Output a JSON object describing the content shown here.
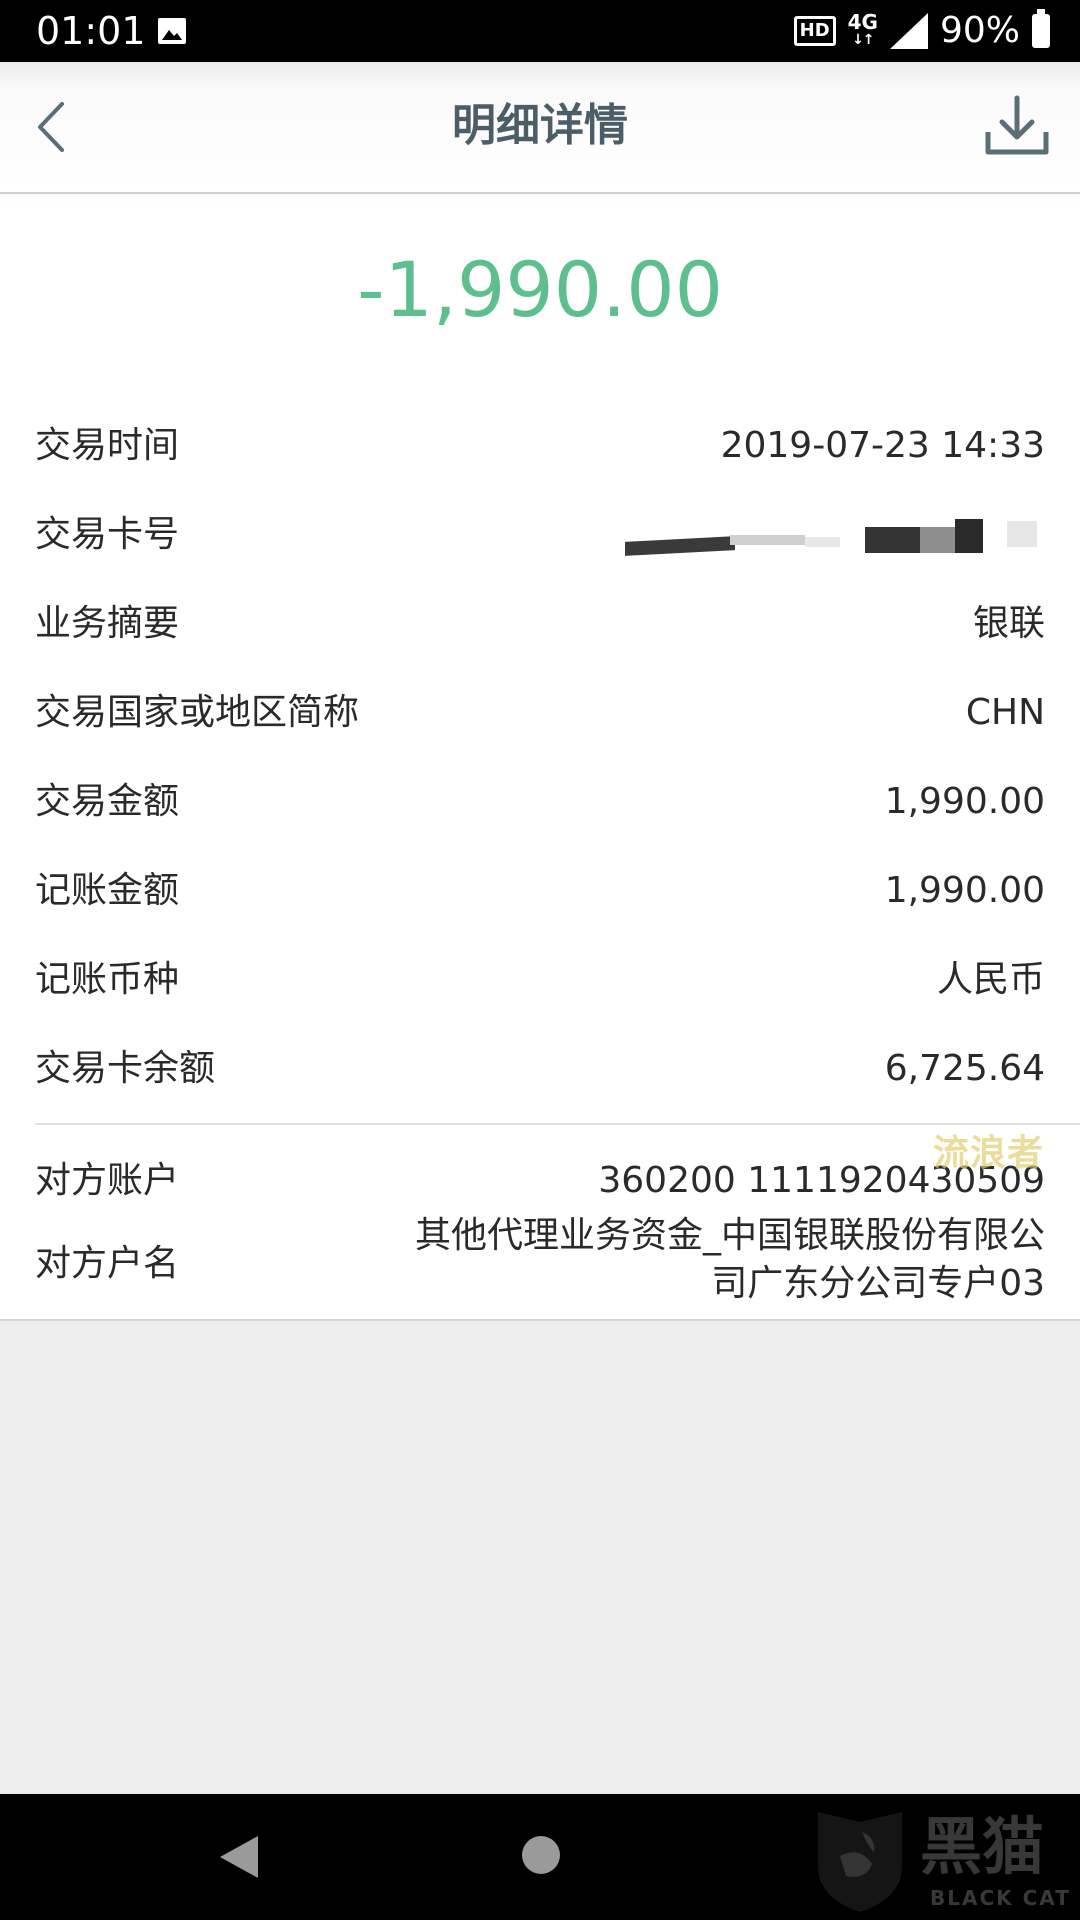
{
  "status_bar": {
    "time": "01:01",
    "hd": "HD",
    "network": "4G",
    "battery": "90%",
    "icons": [
      "photo-icon",
      "signal-icon",
      "battery-icon"
    ]
  },
  "header": {
    "title": "明细详情",
    "back_icon": "chevron-left-icon",
    "download_icon": "download-icon"
  },
  "amount": "-1,990.00",
  "details": [
    {
      "label": "交易时间",
      "value": "2019-07-23 14:33"
    },
    {
      "label": "交易卡号",
      "value": ""
    },
    {
      "label": "业务摘要",
      "value": "银联"
    },
    {
      "label": "交易国家或地区简称",
      "value": "CHN"
    },
    {
      "label": "交易金额",
      "value": "1,990.00"
    },
    {
      "label": "记账金额",
      "value": "1,990.00"
    },
    {
      "label": "记账币种",
      "value": "人民币"
    },
    {
      "label": "交易卡余额",
      "value": "6,725.64"
    }
  ],
  "counterparty": {
    "account_label": "对方账户",
    "account_value": "360200 1111920430509",
    "name_label": "对方户名",
    "name_line1": "其他代理业务资金_中国银联股份有限公",
    "name_line2": "司广东分公司专户03"
  },
  "watermark": "流浪者",
  "footer_logo": {
    "cn": "黑猫",
    "en": "BLACK CAT"
  },
  "colors": {
    "amount": "#5cbf8d",
    "title": "#4b5e68",
    "accent": "#5a6e78"
  }
}
